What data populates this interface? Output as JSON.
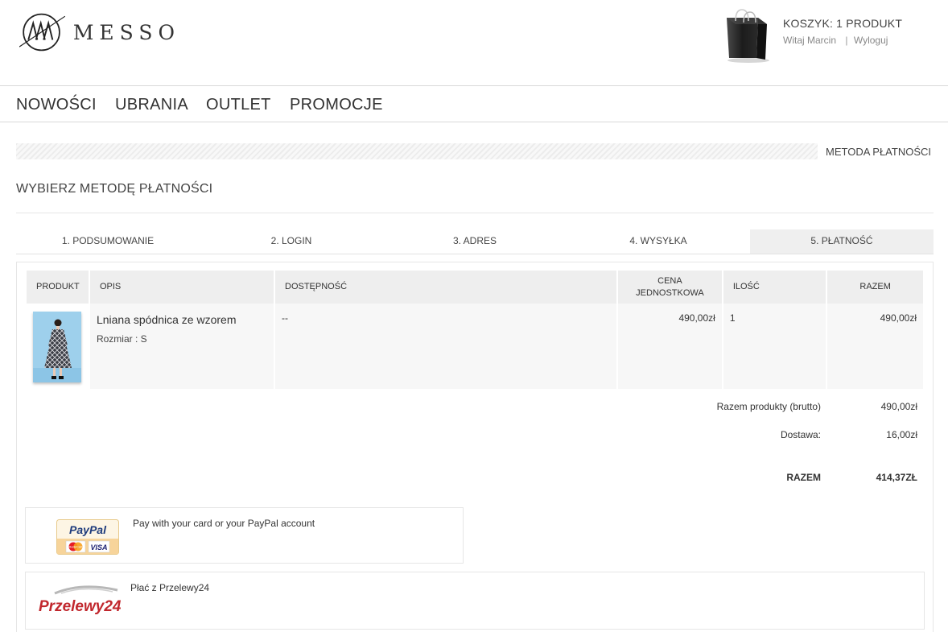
{
  "brand": {
    "name": "MESSO"
  },
  "cart": {
    "title": "KOSZYK: 1 PRODUKT",
    "greeting": "Witaj",
    "user": "Marcin",
    "logout": "Wyloguj"
  },
  "nav": [
    "NOWOŚCI",
    "UBRANIA",
    "OUTLET",
    "PROMOCJE"
  ],
  "breadcrumb": "METODA PŁATNOŚCI",
  "page_title": "WYBIERZ METODĘ PŁATNOŚCI",
  "steps": [
    "1. PODSUMOWANIE",
    "2. LOGIN",
    "3. ADRES",
    "4. WYSYŁKA",
    "5. PŁATNOŚĆ"
  ],
  "active_step": 5,
  "table": {
    "headers": {
      "product": "PRODUKT",
      "desc": "OPIS",
      "avail": "DOSTĘPNOŚĆ",
      "unit_price_1": "CENA",
      "unit_price_2": "JEDNOSTKOWA",
      "qty": "ILOŚĆ",
      "total": "RAZEM"
    },
    "rows": [
      {
        "name": "Lniana spódnica ze wzorem",
        "size": "Rozmiar : S",
        "availability": "--",
        "unit_price": "490,00zł",
        "quantity": "1",
        "total": "490,00zł"
      }
    ]
  },
  "summary": {
    "products_label": "Razem produkty (brutto)",
    "products_value": "490,00zł",
    "shipping_label": "Dostawa:",
    "shipping_value": "16,00zł",
    "total_label": "RAZEM",
    "total_value": "414,37ZŁ"
  },
  "payments": {
    "paypal": {
      "logo_text": "PayPal",
      "mastercard": "MasterCard",
      "visa": "VISA",
      "description": "Pay with your card or your PayPal account"
    },
    "przelewy": {
      "logo_text": "Przelewy24",
      "description": "Płać z Przelewy24"
    }
  },
  "colors": {
    "accent_red": "#c1272d",
    "paypal_navy": "#1d3a7b",
    "paypal_blue": "#2a9bd8"
  }
}
